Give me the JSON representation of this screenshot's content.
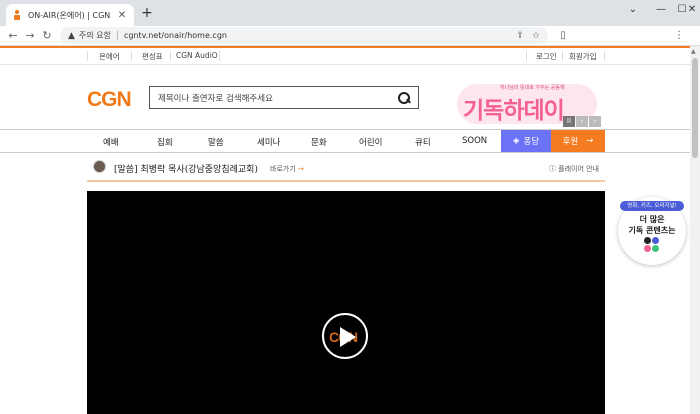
{
  "browser": {
    "tab_title": "ON-AIR(온에어) | CGN",
    "tab_close": "✕",
    "new_tab": "+",
    "window_controls": [
      "—",
      "☐",
      "✕"
    ],
    "nav": {
      "back": "←",
      "forward": "→",
      "reload": "↻"
    },
    "security_icon": "▲",
    "security_label": "주의 요함",
    "url": "cgntv.net/onair/home.cgn",
    "omnibox_icons": [
      "⇪",
      "☆"
    ],
    "toolbar_icons": [
      "▯",
      "⋮"
    ]
  },
  "topnav": {
    "left": [
      "온에어",
      "편성표",
      "CGN AudiO"
    ],
    "right": [
      "로그인",
      "회원가입"
    ]
  },
  "header": {
    "logo": "CGN",
    "search_placeholder": "제목이나 출연자로 검색해주세요",
    "banner_sub": "하나님의 뜻대로 가꾸는 공동체",
    "banner_title": "기독하데이",
    "banner_controls": [
      "II",
      "‹",
      "›"
    ]
  },
  "mainnav": {
    "items": [
      "예배",
      "집회",
      "말씀",
      "세미나",
      "문화",
      "어린이",
      "큐티",
      "SOON"
    ],
    "pong": "퐁당",
    "donate": "후원",
    "donate_arrow": "→"
  },
  "program": {
    "title": "[말씀] 최병락 목사(강남중앙침례교회)",
    "go_label": "바로가기",
    "go_arrow": "→",
    "player_guide": "ⓘ 플레이어 안내"
  },
  "player": {
    "logo": "CGN"
  },
  "promo": {
    "pill": "영화, 키즈, 오리지널!",
    "line1": "더 많은",
    "line2": "기독 콘텐츠는"
  },
  "colors": {
    "brand": "#f47b20",
    "pong": "#6b72f5",
    "banner": "#f4608f"
  }
}
